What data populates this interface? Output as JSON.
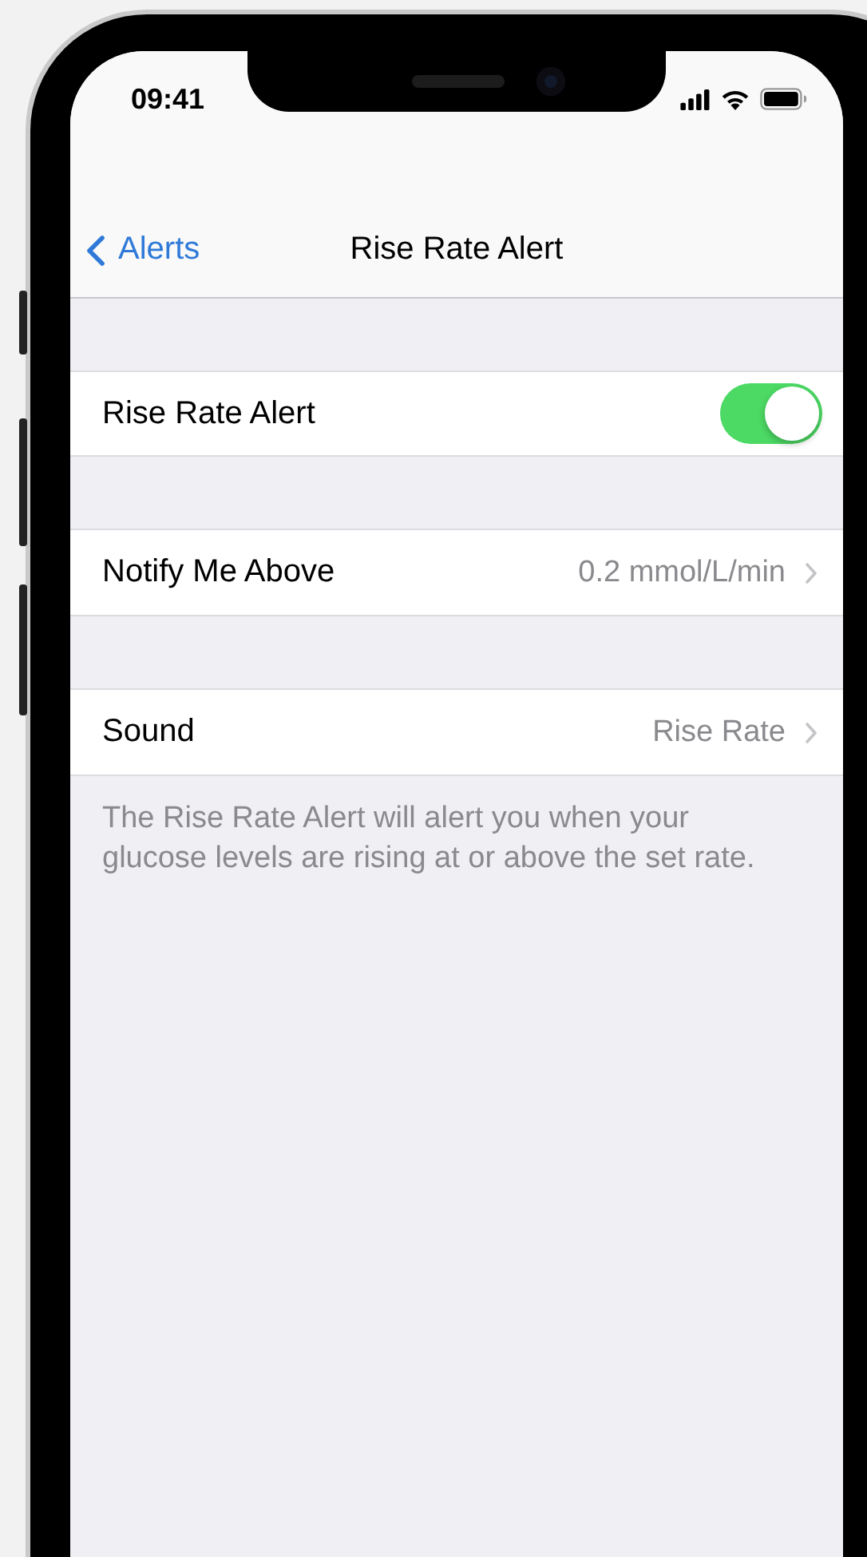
{
  "status_bar": {
    "time": "09:41"
  },
  "nav": {
    "back": "Alerts",
    "title": "Rise Rate Alert"
  },
  "rows": [
    {
      "kind": "toggle",
      "label": "Rise Rate Alert",
      "on": true
    },
    {
      "kind": "link",
      "label": "Notify Me Above",
      "value": "0.2 mmol/L/min"
    },
    {
      "kind": "link",
      "label": "Sound",
      "value": "Rise Rate"
    }
  ],
  "footer": "The Rise Rate Alert will alert you when your glucose levels are rising at or above the set rate."
}
